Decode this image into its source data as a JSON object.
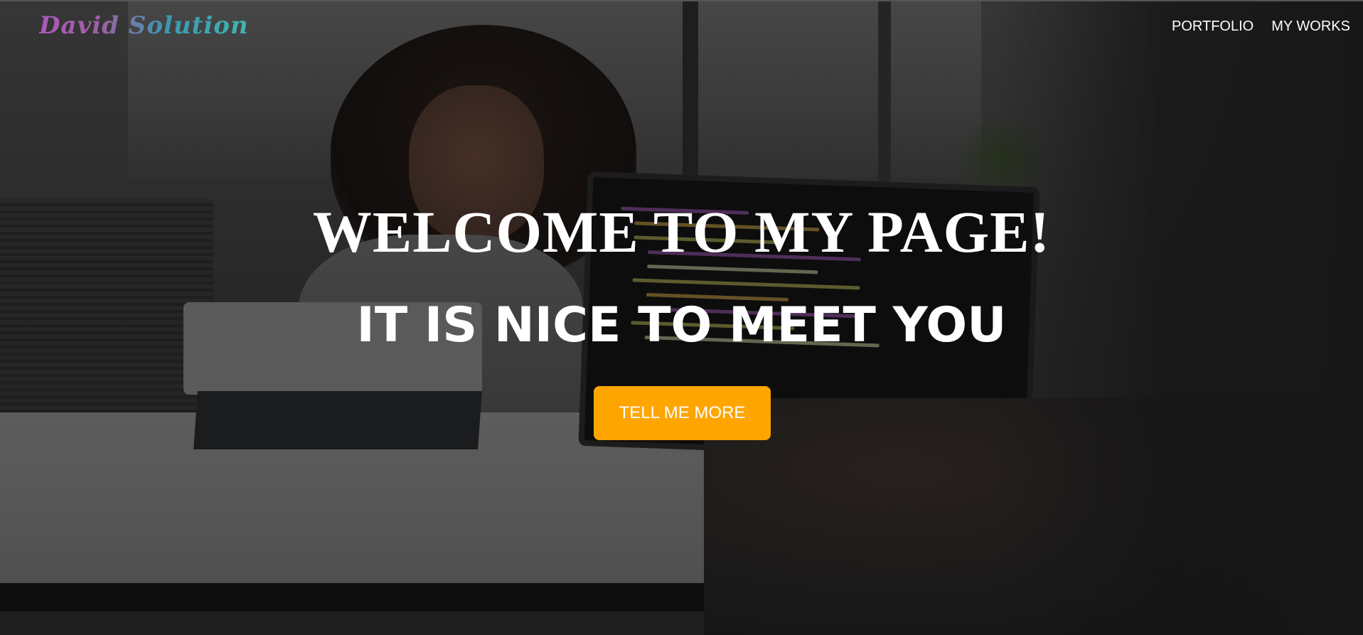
{
  "nav": {
    "logo_text": "David Solution",
    "links": [
      {
        "label": "PORTFOLIO"
      },
      {
        "label": "MY WORKS"
      }
    ]
  },
  "hero": {
    "headline": "WELCOME TO MY PAGE!",
    "subheadline": "IT IS NICE TO MEET YOU",
    "cta_label": "TELL ME MORE"
  },
  "colors": {
    "cta_background": "#ffa500",
    "text": "#ffffff",
    "logo_gradient": [
      "#c060d0",
      "#3aa6c8",
      "#40c8c0"
    ]
  }
}
